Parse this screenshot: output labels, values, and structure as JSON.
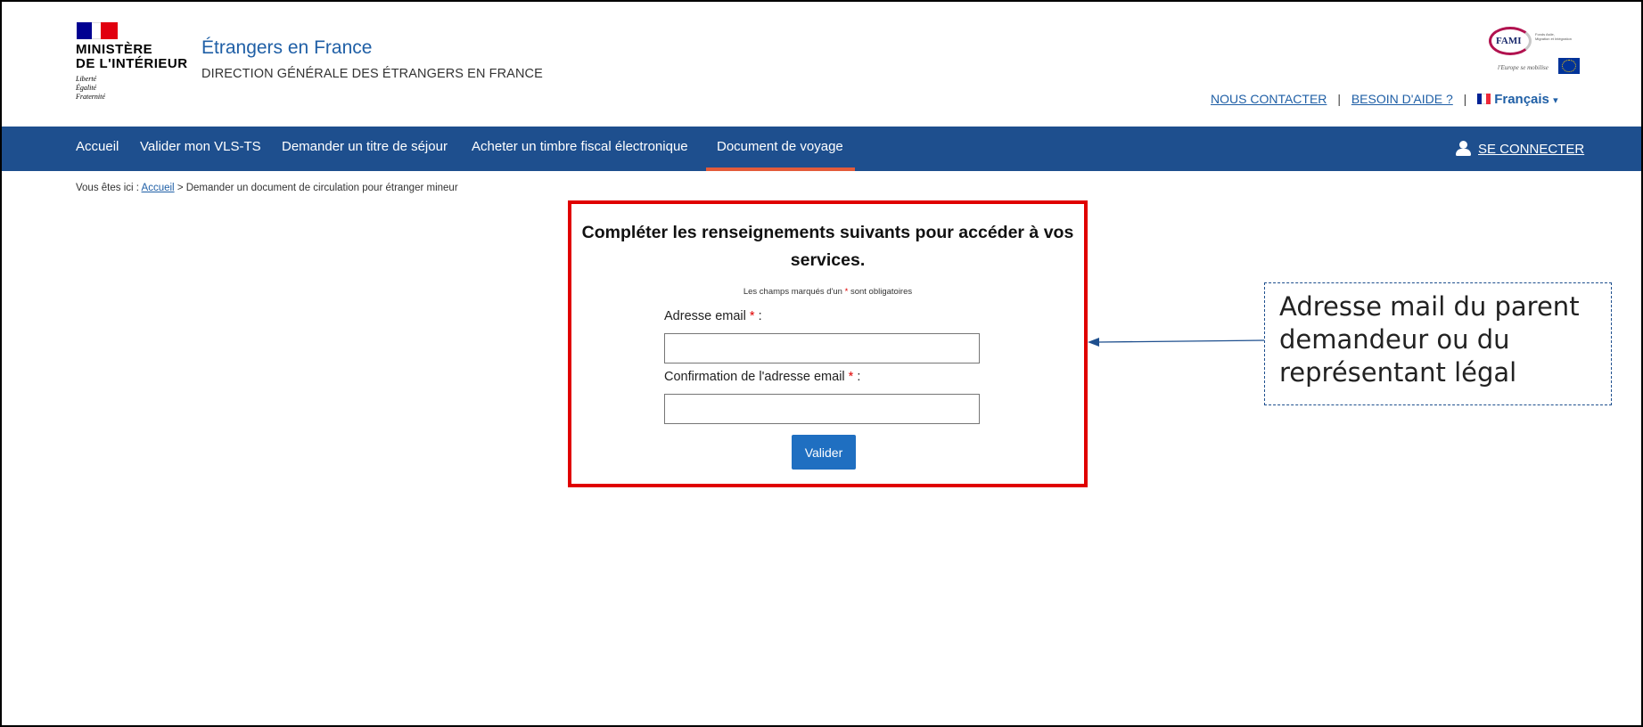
{
  "header": {
    "ministry_line1": "MINISTÈRE",
    "ministry_line2": "DE L'INTÉRIEUR",
    "motto": [
      "Liberté",
      "Égalité",
      "Fraternité"
    ],
    "site_title": "Étrangers en France",
    "site_subtitle": "DIRECTION GÉNÉRALE DES ÉTRANGERS EN FRANCE",
    "fami_logo": {
      "name": "FAMI",
      "small_text": [
        "Fonds Asile,",
        "Migration et Intégration"
      ],
      "tagline": "l'Europe se mobilise"
    },
    "links": {
      "contact": "NOUS CONTACTER",
      "help": "BESOIN D'AIDE ?",
      "separator": "|",
      "language": "Français",
      "language_caret": "▾"
    }
  },
  "nav": {
    "items": [
      "Accueil",
      "Valider mon VLS-TS",
      "Demander un titre de séjour",
      "Acheter un timbre fiscal électronique",
      "Document de voyage"
    ],
    "active_index": 4,
    "login_label": "SE CONNECTER"
  },
  "breadcrumb": {
    "prefix": "Vous êtes ici :",
    "home": "Accueil",
    "separator": ">",
    "current": "Demander un document de circulation pour étranger mineur"
  },
  "form": {
    "title": "Compléter les renseignements suivants pour accéder à vos services.",
    "required_note_before": "Les champs marqués d'un",
    "required_star": "*",
    "required_note_after": "sont obligatoires",
    "email_label": "Adresse email",
    "confirm_label": "Confirmation de l'adresse email",
    "label_suffix": ":",
    "email_value": "",
    "confirm_value": "",
    "submit_label": "Valider"
  },
  "annotation": {
    "text": "Adresse mail du parent demandeur ou du représentant légal"
  },
  "colors": {
    "nav_background": "#1e4f8e",
    "link_blue": "#1f5fa6",
    "highlight_red": "#e00000",
    "button_blue": "#1f6fc1",
    "active_underline": "#e35b3a"
  }
}
